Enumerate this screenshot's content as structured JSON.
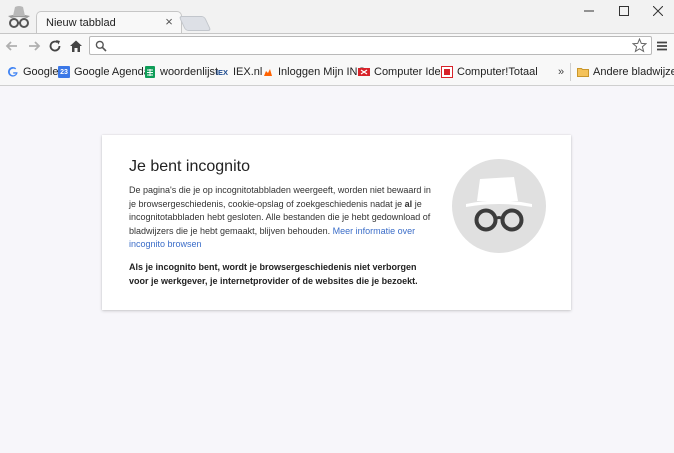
{
  "tab": {
    "title": "Nieuw tabblad"
  },
  "omnibox": {
    "value": "",
    "placeholder": ""
  },
  "bookmarks": [
    {
      "label": "Google",
      "icon": "google-icon"
    },
    {
      "label": "Google Agenda",
      "icon": "calendar-icon",
      "badge": "23"
    },
    {
      "label": "woordenlijst",
      "icon": "sheet-icon"
    },
    {
      "label": "IEX.nl",
      "icon": "iex-icon",
      "badge": "IEX"
    },
    {
      "label": "Inloggen Mijn ING",
      "icon": "ing-lion-icon"
    },
    {
      "label": "Computer Idee",
      "icon": "computer-idee-icon"
    },
    {
      "label": "Computer!Totaal",
      "icon": "computer-totaal-icon"
    }
  ],
  "bookmarks_overflow": "»",
  "other_bookmarks": "Andere bladwijzers",
  "content": {
    "title": "Je bent incognito",
    "body_before": "De pagina's die je op incognitotabbladen weergeeft, worden niet bewaard in je browsergeschiedenis, cookie-opslag of zoekgeschiedenis nadat je ",
    "body_bold": "al",
    "body_after": " je incognitotabbladen hebt gesloten. Alle bestanden die je hebt gedownload of bladwijzers die je hebt gemaakt, blijven behouden. ",
    "link": "Meer informatie over incognito browsen",
    "warning": "Als je incognito bent, wordt je browsergeschiedenis niet verborgen voor je werkgever, je internetprovider of de websites die je bezoekt."
  },
  "colors": {
    "link": "#3b6dc8",
    "page_background": "#f7f6fa",
    "illustration_circle": "#e0e0e0"
  }
}
